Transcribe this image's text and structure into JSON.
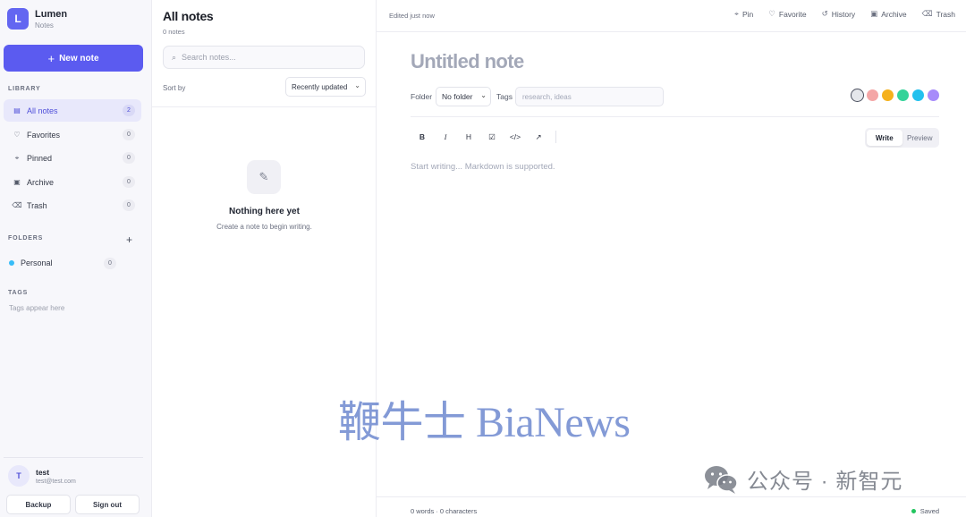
{
  "app": {
    "initial": "L",
    "name": "Lumen",
    "subtitle": "Notes"
  },
  "sidebar": {
    "new_note_label": "New note",
    "library_label": "LIBRARY",
    "library_items": [
      {
        "label": "All notes",
        "count": "2",
        "icon": "list-icon"
      },
      {
        "label": "Favorites",
        "count": "0",
        "icon": "heart-icon"
      },
      {
        "label": "Pinned",
        "count": "0",
        "icon": "pin-icon"
      },
      {
        "label": "Archive",
        "count": "0",
        "icon": "archive-icon"
      },
      {
        "label": "Trash",
        "count": "0",
        "icon": "trash-icon"
      }
    ],
    "folders_label": "FOLDERS",
    "folders": [
      {
        "label": "Personal",
        "count": "0",
        "color": "#38bdf8"
      }
    ],
    "tags_label": "TAGS",
    "tags_empty": "Tags appear here",
    "user": {
      "initial": "T",
      "name": "test",
      "email": "test@test.com"
    },
    "backup_label": "Backup",
    "signout_label": "Sign out"
  },
  "list": {
    "title": "All notes",
    "count_text": "0 notes",
    "search_placeholder": "Search notes...",
    "sort_label": "Sort by",
    "sort_value": "Recently updated",
    "empty_title": "Nothing here yet",
    "empty_subtitle": "Create a note to begin writing."
  },
  "editor": {
    "edited_text": "Edited just now",
    "actions": [
      {
        "label": "Pin",
        "icon": "pin-icon"
      },
      {
        "label": "Favorite",
        "icon": "heart-icon"
      },
      {
        "label": "History",
        "icon": "history-icon"
      },
      {
        "label": "Archive",
        "icon": "archive-icon"
      },
      {
        "label": "Trash",
        "icon": "trash-icon"
      }
    ],
    "title_placeholder": "Untitled note",
    "folder_label": "Folder",
    "folder_value": "No folder",
    "tags_label": "Tags",
    "tags_placeholder": "research, ideas",
    "colors": [
      "#e5e7eb",
      "#f4a6a6",
      "#f5b11c",
      "#34d399",
      "#22c1ee",
      "#a78bfa"
    ],
    "toolbar": [
      {
        "label": "B",
        "name": "bold-button"
      },
      {
        "label": "I",
        "name": "italic-button"
      },
      {
        "label": "H",
        "name": "heading-button"
      },
      {
        "label": "☑",
        "name": "checklist-button"
      },
      {
        "label": "</>",
        "name": "code-button"
      },
      {
        "label": "↗",
        "name": "link-button"
      }
    ],
    "mode_write": "Write",
    "mode_preview": "Preview",
    "body_placeholder": "Start writing... Markdown is supported.",
    "word_count": "0 words · 0 characters",
    "saved_label": "Saved"
  },
  "watermark": {
    "main": "鞭牛士 BiaNews",
    "wechat": "公众号 · 新智元"
  }
}
